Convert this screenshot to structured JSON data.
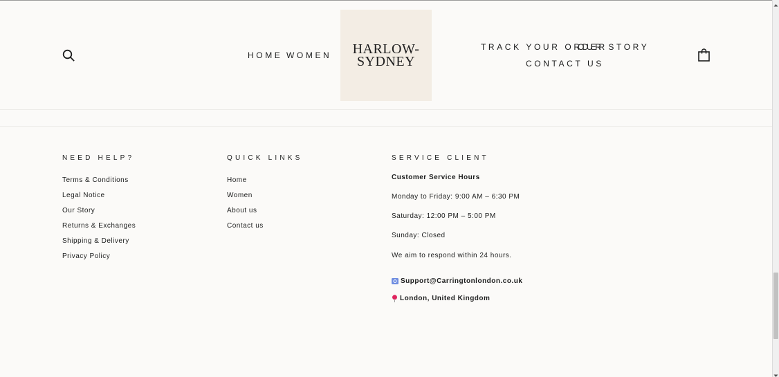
{
  "header": {
    "left_nav": [
      {
        "label": "HOME"
      },
      {
        "label": "WOMEN"
      }
    ],
    "logo": {
      "line1": "HARLOW-",
      "line2": "SYDNEY"
    },
    "right_nav": [
      {
        "label": "TRACK YOUR ORDER"
      },
      {
        "label": "OUR STORY"
      },
      {
        "label": "CONTACT US"
      }
    ],
    "icons": {
      "search": "search-icon",
      "cart": "shopping-bag-icon"
    }
  },
  "footer": {
    "need_help": {
      "title": "NEED HELP?",
      "links": [
        "Terms & Conditions",
        "Legal Notice",
        "Our Story",
        "Returns & Exchanges",
        "Shipping & Delivery",
        "Privacy Policy"
      ]
    },
    "quick_links": {
      "title": "QUICK LINKS",
      "links": [
        "Home",
        "Women",
        "About us",
        "Contact us"
      ]
    },
    "service_client": {
      "title": "SERVICE CLIENT",
      "hours_title": "Customer Service Hours",
      "weekday": "Monday to Friday: 9:00 AM – 6:30 PM",
      "saturday": "Saturday: 12:00 PM – 5:00 PM",
      "sunday": "Sunday: Closed",
      "response": "We aim to respond within 24 hours.",
      "email": "Support@Carringtonlondon.co.uk",
      "location": "London, United Kingdom",
      "email_icon": "email-icon",
      "location_icon": "pin-icon"
    }
  },
  "colors": {
    "background": "#fbfaf8",
    "text": "#1c1d1d",
    "logo_bg": "#f3ede4",
    "pin": "#e0245e",
    "email_icon": "#6f8de0"
  }
}
